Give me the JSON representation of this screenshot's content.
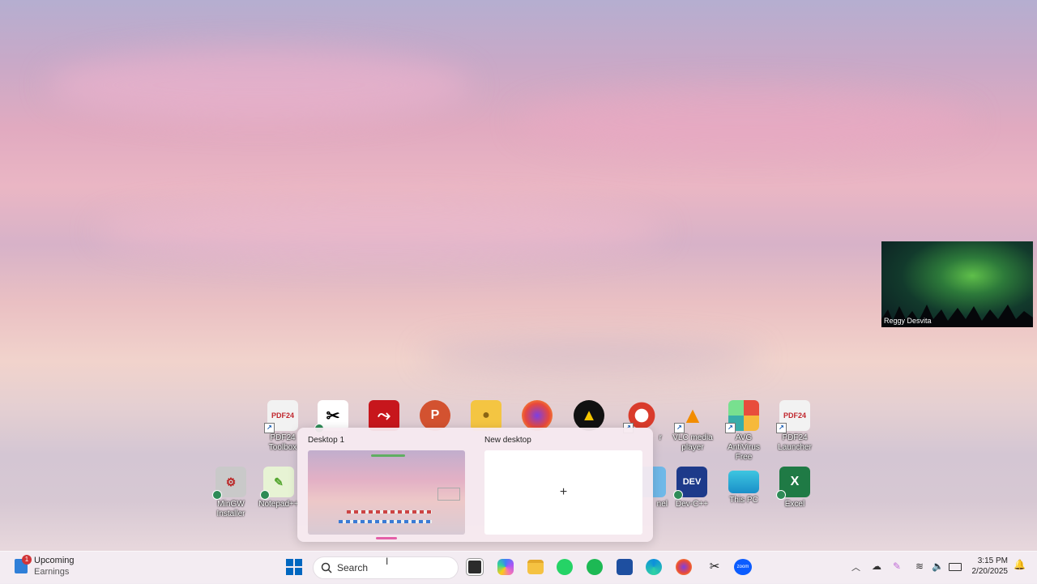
{
  "desktop": {
    "row1": [
      {
        "label": "PDF24\nToolbox",
        "icon": "pdf24-icon"
      },
      {
        "label": "",
        "icon": "capcut-icon"
      },
      {
        "label": "",
        "icon": "acrobat-icon"
      },
      {
        "label": "",
        "icon": "powerpoint-icon"
      },
      {
        "label": "",
        "icon": "user-folder-icon"
      },
      {
        "label": "",
        "icon": "firefox-icon"
      },
      {
        "label": "",
        "icon": "aimp-icon"
      },
      {
        "label": "r",
        "icon": "ccleaner-icon"
      },
      {
        "label": "VLC media\nplayer",
        "icon": "vlc-icon"
      },
      {
        "label": "AVG AntiVirus\nFree",
        "icon": "avg-icon"
      },
      {
        "label": "PDF24\nLauncher",
        "icon": "pdf24-icon"
      }
    ],
    "row2": [
      {
        "label": "MinGW\nInstaller",
        "icon": "mingw-installer-icon"
      },
      {
        "label": "Notepad++",
        "icon": "notepad-plus-icon"
      },
      {
        "label": "nel",
        "icon": "control-panel-icon"
      },
      {
        "label": "Dev-C++",
        "icon": "dev-cpp-icon"
      },
      {
        "label": "This PC",
        "icon": "this-pc-icon"
      },
      {
        "label": "Excel",
        "icon": "excel-icon"
      }
    ]
  },
  "webcam": {
    "name": "Reggy Desvita"
  },
  "task_view": {
    "desktops": [
      {
        "title": "Desktop 1"
      },
      {
        "title": "New desktop",
        "action": "+"
      }
    ]
  },
  "taskbar": {
    "widget": {
      "badge": "1",
      "title": "Upcoming",
      "subtitle": "Earnings"
    },
    "search_placeholder": "Search",
    "apps": [
      "windows-start-icon",
      "task-view-icon",
      "copilot-icon",
      "file-explorer-icon",
      "whatsapp-icon",
      "spotify-icon",
      "ms-store-icon",
      "edge-icon",
      "firefox-icon",
      "capcut-icon",
      "zoom-icon"
    ],
    "zoom_label": "zoom",
    "tray": {
      "time": "3:15 PM",
      "date": "2/20/2025"
    }
  },
  "colors": {
    "accent": "#0067c0",
    "active_indicator": "#e45fa8"
  }
}
